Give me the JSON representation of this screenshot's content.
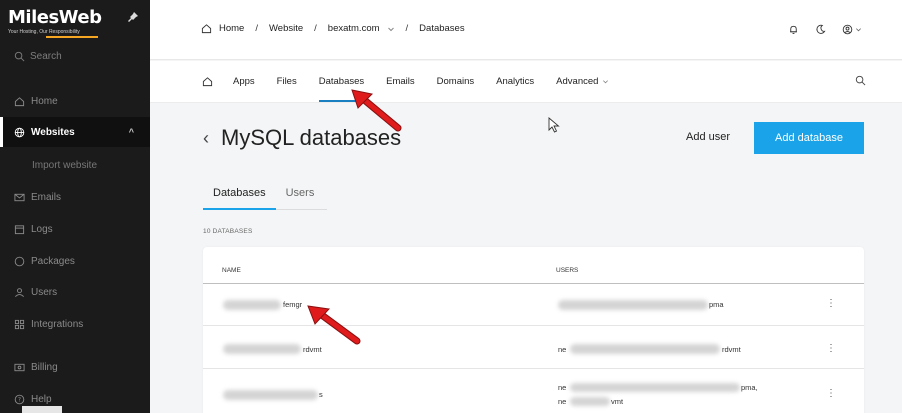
{
  "sidebar": {
    "logo": "MilesWeb",
    "logo_tagline": "Your Hosting, Our Responsibility",
    "search": "Search",
    "items": [
      {
        "label": "Home",
        "icon": "home-icon"
      },
      {
        "label": "Websites",
        "icon": "globe-icon"
      },
      {
        "label": "Emails",
        "icon": "mail-icon"
      },
      {
        "label": "Logs",
        "icon": "calendar-icon"
      },
      {
        "label": "Packages",
        "icon": "package-icon"
      },
      {
        "label": "Users",
        "icon": "users-icon"
      },
      {
        "label": "Integrations",
        "icon": "grid-icon"
      },
      {
        "label": "Billing",
        "icon": "billing-icon"
      },
      {
        "label": "Help",
        "icon": "help-icon"
      }
    ],
    "subitem": "Import website"
  },
  "breadcrumb": {
    "home": "Home",
    "website": "Website",
    "domain": "bexatm.com",
    "current": "Databases"
  },
  "nav": {
    "items": [
      "Apps",
      "Files",
      "Databases",
      "Emails",
      "Domains",
      "Analytics",
      "Advanced"
    ]
  },
  "page": {
    "title": "MySQL databases",
    "add_user": "Add user",
    "add_database": "Add database",
    "tabs": [
      "Databases",
      "Users"
    ],
    "count": "10 DATABASES"
  },
  "table": {
    "headers": [
      "NAME",
      "USERS"
    ],
    "rows": [
      {
        "name": "femgr",
        "users": "pma"
      },
      {
        "name": "rdvmt",
        "users_pre": "ne",
        "users": "rdvmt"
      },
      {
        "name": "s",
        "users_line1_pre": "ne",
        "users_line1": "pma,",
        "users_line2_pre": "ne",
        "users_line2": "vmt"
      }
    ]
  },
  "colors": {
    "accent": "#1aa3e8",
    "sidebar_bg": "#1b1b1b",
    "arrow": "#e01b1b"
  }
}
